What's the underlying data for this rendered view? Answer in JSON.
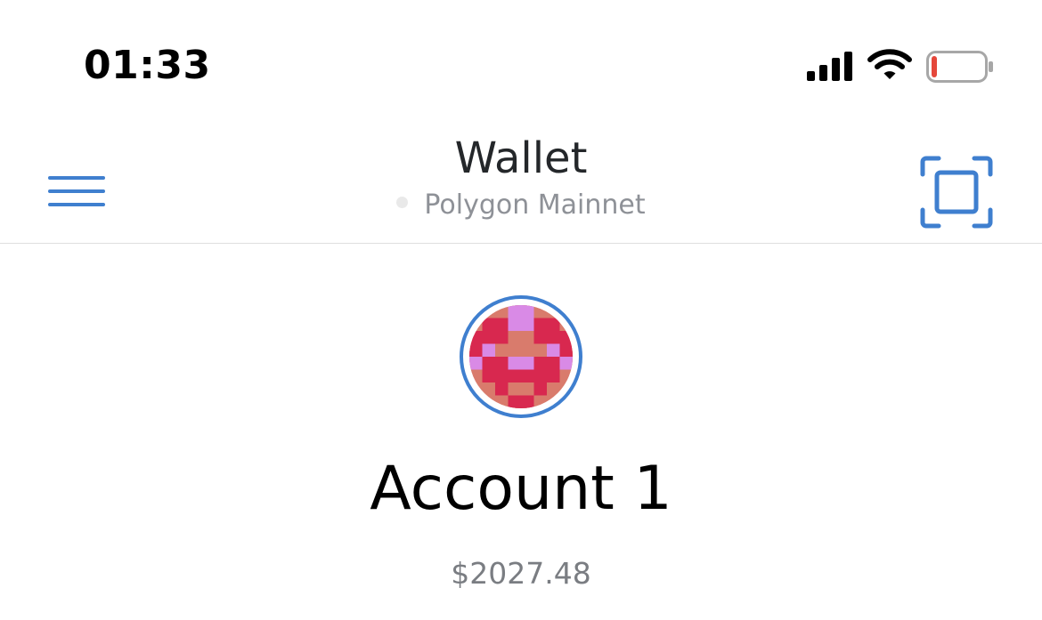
{
  "status_bar": {
    "time": "01:33",
    "signal_icon": "cellular-signal-icon",
    "wifi_icon": "wifi-icon",
    "battery_icon": "battery-low-icon",
    "battery_level_fraction": 0.1
  },
  "navbar": {
    "title": "Wallet",
    "network": "Polygon Mainnet",
    "menu_icon": "hamburger-menu-icon",
    "scan_icon": "qr-scan-icon"
  },
  "account": {
    "name": "Account 1",
    "balance": "$2027.48",
    "avatar_icon": "identicon-avatar"
  },
  "colors": {
    "accent": "#3f7fcf",
    "battery_low": "#e5473b",
    "identicon_base": "#d97b6c",
    "identicon_dark": "#d8284f",
    "identicon_light": "#d98ae6"
  }
}
